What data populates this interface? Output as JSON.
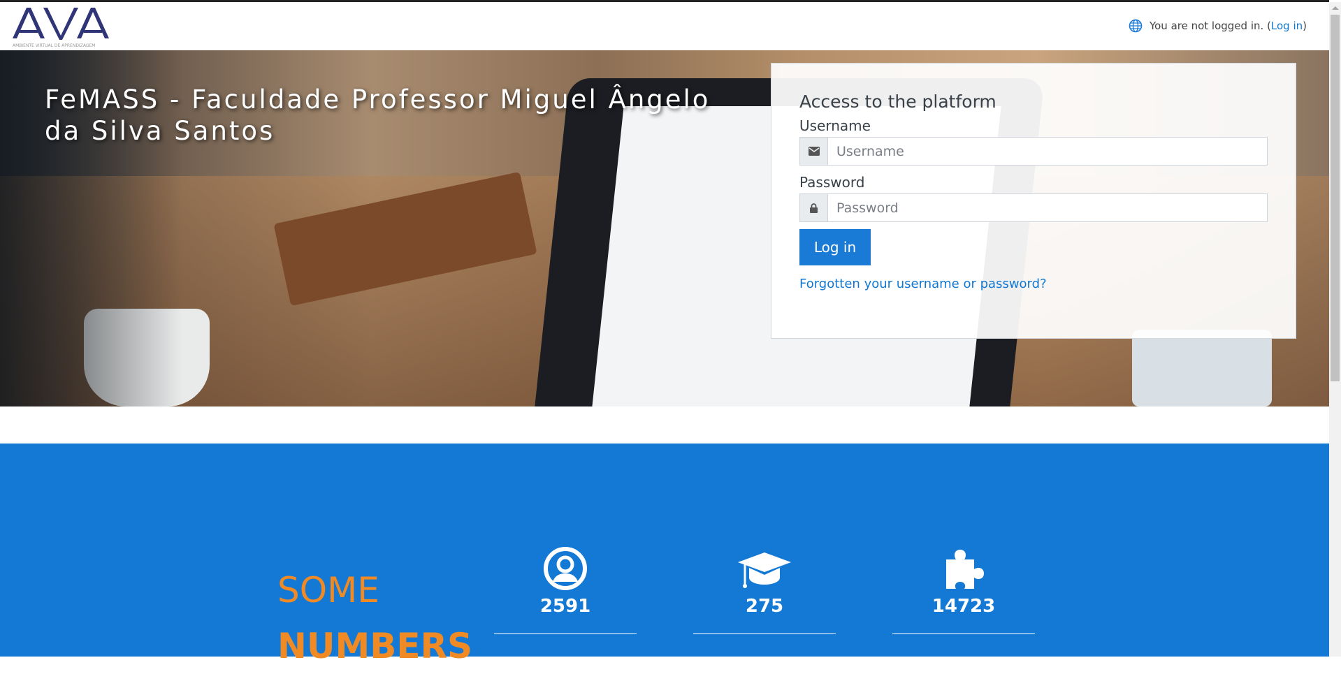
{
  "header": {
    "logo_text": "AVA",
    "logo_subtitle": "AMBIENTE VIRTUAL DE APRENDIZAGEM",
    "not_logged": "You are not logged in. (",
    "login_link": "Log in",
    "close_paren": ")"
  },
  "hero": {
    "title": "FeMASS - Faculdade Professor Miguel Ângelo da Silva Santos"
  },
  "login": {
    "heading": "Access to the platform",
    "username_label": "Username",
    "username_placeholder": "Username",
    "password_label": "Password",
    "password_placeholder": "Password",
    "button": "Log in",
    "forgot": "Forgotten your username or password?"
  },
  "stats": {
    "title_line1": "SOME",
    "title_line2": "NUMBERS",
    "items": [
      {
        "icon": "user-circle-icon",
        "value": "2591"
      },
      {
        "icon": "graduation-cap-icon",
        "value": "275"
      },
      {
        "icon": "puzzle-piece-icon",
        "value": "14723"
      }
    ]
  },
  "colors": {
    "accent": "#1479d4",
    "orange": "#f08a24",
    "link": "#1177d1"
  }
}
